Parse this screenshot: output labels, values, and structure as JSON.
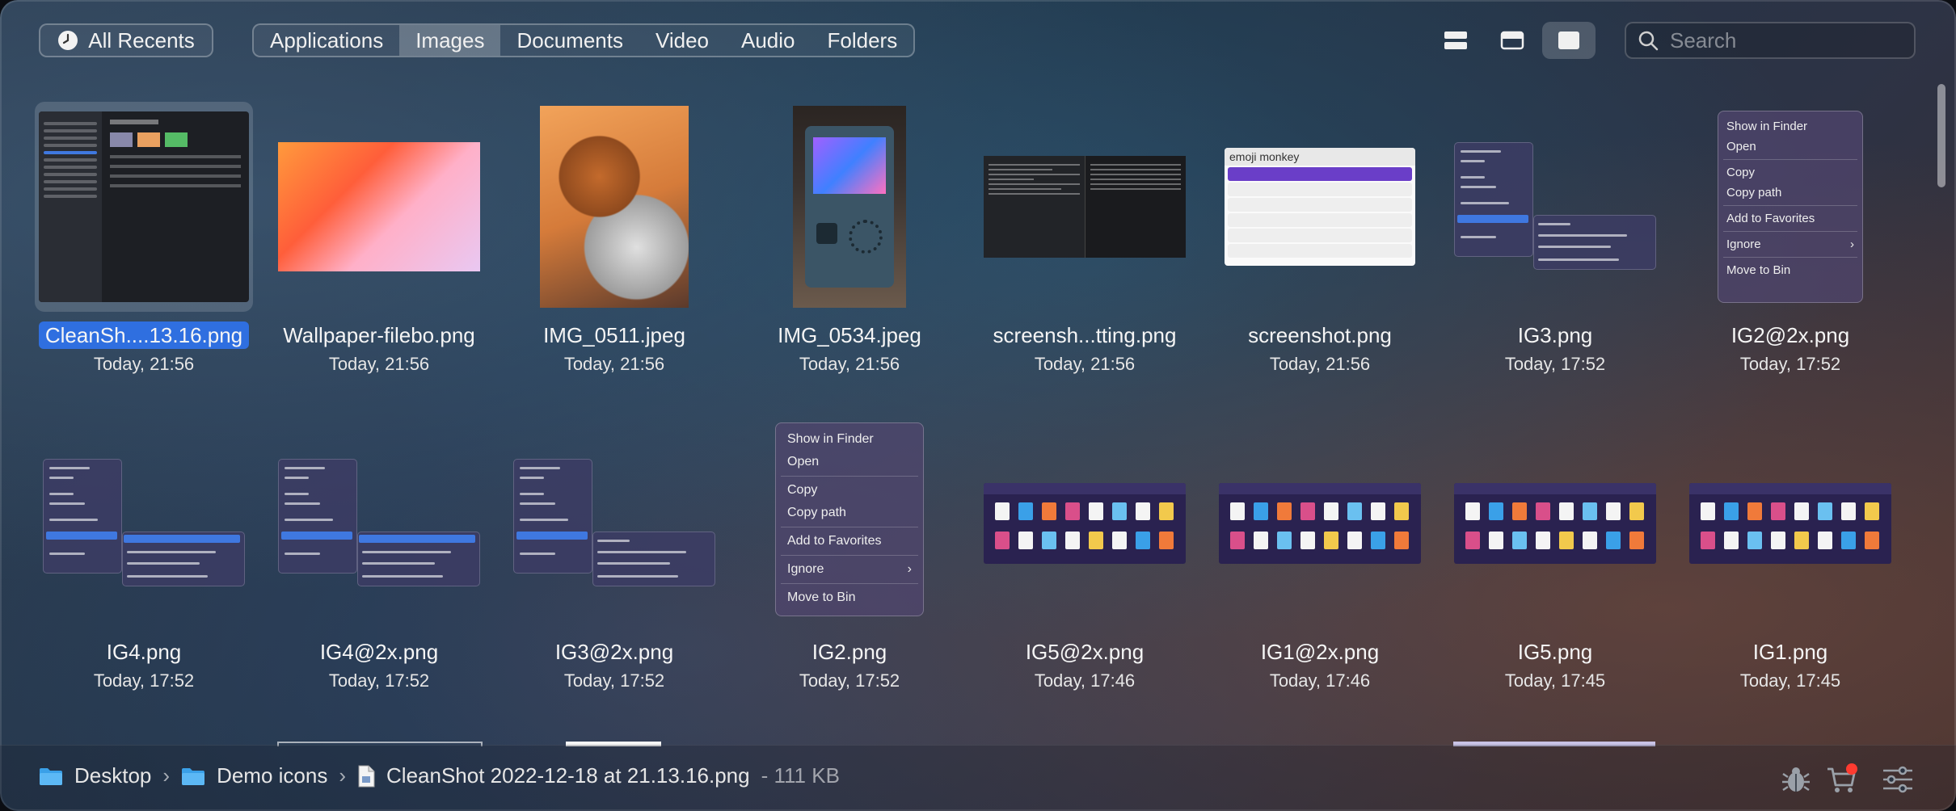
{
  "topbar": {
    "all_recents_label": "All Recents",
    "tabs": [
      {
        "label": "Applications",
        "active": false
      },
      {
        "label": "Images",
        "active": true
      },
      {
        "label": "Documents",
        "active": false
      },
      {
        "label": "Video",
        "active": false
      },
      {
        "label": "Audio",
        "active": false
      },
      {
        "label": "Folders",
        "active": false
      }
    ],
    "view_modes": [
      "list-view-icon",
      "compact-view-icon",
      "grid-view-icon"
    ],
    "active_view": "grid-view-icon",
    "search_placeholder": "Search"
  },
  "files": [
    {
      "name": "CleanSh....13.16.png",
      "date": "Today, 21:56",
      "selected": true,
      "thumb": "screenshot"
    },
    {
      "name": "Wallpaper-filebo.png",
      "date": "Today, 21:56",
      "thumb": "wallpaper"
    },
    {
      "name": "IMG_0511.jpeg",
      "date": "Today, 21:56",
      "thumb": "photo-dog"
    },
    {
      "name": "IMG_0534.jpeg",
      "date": "Today, 21:56",
      "thumb": "photo-console"
    },
    {
      "name": "screensh...tting.png",
      "date": "Today, 21:56",
      "thumb": "terminal"
    },
    {
      "name": "screenshot.png",
      "date": "Today, 21:56",
      "thumb": "emoji"
    },
    {
      "name": "IG3.png",
      "date": "Today, 17:52",
      "thumb": "mini-ctx"
    },
    {
      "name": "IG2@2x.png",
      "date": "Today, 17:52",
      "thumb": "context-menu"
    },
    {
      "name": "IG4.png",
      "date": "Today, 17:52",
      "thumb": "mini-ctx"
    },
    {
      "name": "IG4@2x.png",
      "date": "Today, 17:52",
      "thumb": "mini-ctx"
    },
    {
      "name": "IG3@2x.png",
      "date": "Today, 17:52",
      "thumb": "mini-ctx"
    },
    {
      "name": "IG2.png",
      "date": "Today, 17:52",
      "thumb": "context-menu"
    },
    {
      "name": "IG5@2x.png",
      "date": "Today, 17:46",
      "thumb": "grid"
    },
    {
      "name": "IG1@2x.png",
      "date": "Today, 17:46",
      "thumb": "grid"
    },
    {
      "name": "IG5.png",
      "date": "Today, 17:45",
      "thumb": "grid"
    },
    {
      "name": "IG1.png",
      "date": "Today, 17:45",
      "thumb": "grid"
    }
  ],
  "context_menu": {
    "items": [
      "Show in Finder",
      "Open",
      "Copy",
      "Copy path",
      "Add to Favorites",
      "Ignore",
      "Move to Bin"
    ]
  },
  "emoji_thumb": {
    "header": "emoji monkey"
  },
  "breadcrumb": {
    "items": [
      "Desktop",
      "Demo icons"
    ],
    "file": "CleanShot 2022-12-18 at 21.13.16.png",
    "size": "- 111 KB"
  },
  "bottom_icons": [
    "bug-icon",
    "cart-icon",
    "settings-sliders-icon"
  ],
  "colors": {
    "selection": "#2f6fe0",
    "badge": "#ff3b30",
    "accent_folder": "#3aa0e8"
  }
}
